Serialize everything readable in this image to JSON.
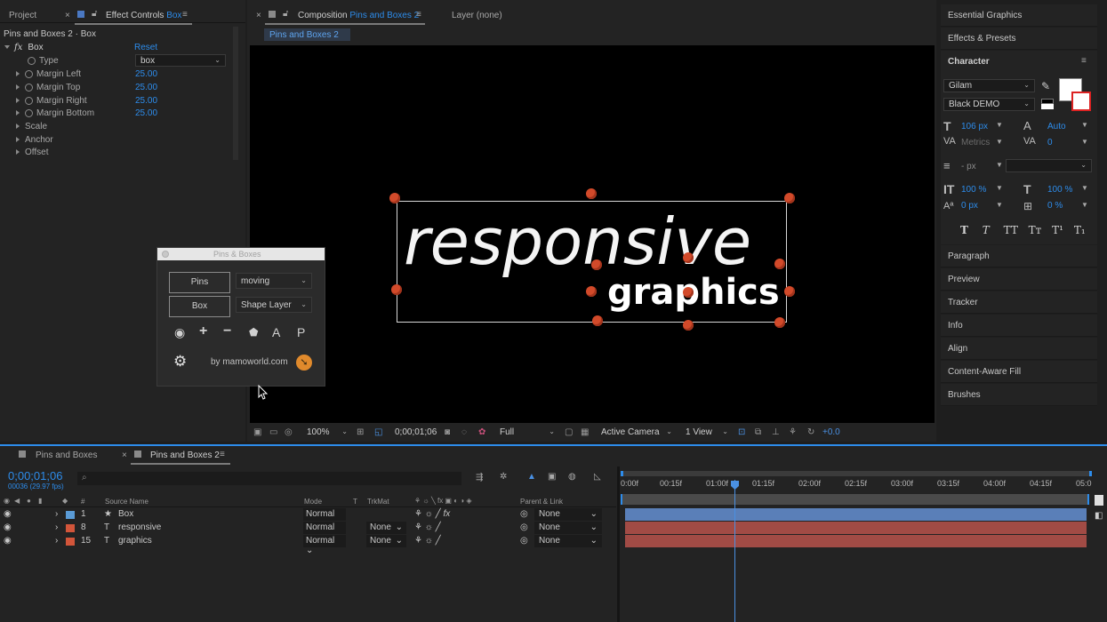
{
  "project_panel": {
    "tab_project": "Project",
    "tab_effect_controls": "Effect Controls",
    "tab_effect_layer": "Box",
    "breadcrumb": "Pins and Boxes 2 · Box",
    "effect_name": "Box",
    "reset": "Reset",
    "props": [
      {
        "label": "Type",
        "value": "box"
      },
      {
        "label": "Margin Left",
        "value": "25.00"
      },
      {
        "label": "Margin Top",
        "value": "25.00"
      },
      {
        "label": "Margin Right",
        "value": "25.00"
      },
      {
        "label": "Margin Bottom",
        "value": "25.00"
      }
    ],
    "groups": [
      "Scale",
      "Anchor",
      "Offset"
    ]
  },
  "composition": {
    "tab_label": "Composition",
    "tab_name": "Pins and Boxes 2",
    "layer_tab": "Layer (none)",
    "sub_tab": "Pins and Boxes 2",
    "text_top": "responsive",
    "text_bottom": "graphics"
  },
  "viewer_toolbar": {
    "zoom": "100%",
    "timecode": "0;00;01;06",
    "resolution": "Full",
    "camera": "Active Camera",
    "views": "1 View",
    "exposure": "+0.0"
  },
  "pins_boxes": {
    "title": "Pins & Boxes",
    "pins_btn": "Pins",
    "pins_mode": "moving",
    "box_btn": "Box",
    "box_mode": "Shape Layer",
    "letter_a": "A",
    "letter_p": "P",
    "credit": "by mamoworld.com"
  },
  "right_panel": {
    "essential_graphics": "Essential Graphics",
    "effects_presets": "Effects & Presets",
    "character": "Character",
    "font_family": "Gilam",
    "font_style": "Black DEMO",
    "font_size": "106 px",
    "leading": "Auto",
    "kerning": "Metrics",
    "tracking": "0",
    "line_px": "- px",
    "vscale": "100 %",
    "hscale": "100 %",
    "baseline": "0 px",
    "tsume": "0 %",
    "sections": [
      "Paragraph",
      "Preview",
      "Tracker",
      "Info",
      "Align",
      "Content-Aware Fill",
      "Brushes"
    ]
  },
  "timeline": {
    "tab1": "Pins and Boxes",
    "tab2": "Pins and Boxes 2",
    "timecode": "0;00;01;06",
    "frame_info": "00036 (29.97 fps)",
    "col_num": "#",
    "col_source": "Source Name",
    "col_mode": "Mode",
    "col_t": "T",
    "col_trkmat": "TrkMat",
    "col_parent": "Parent & Link",
    "ticks": [
      "0:00f",
      "00:15f",
      "01:00f",
      "01:15f",
      "02:00f",
      "02:15f",
      "03:00f",
      "03:15f",
      "04:00f",
      "04:15f",
      "05:0"
    ],
    "layers": [
      {
        "num": "1",
        "type": "★",
        "name": "Box",
        "mode": "Normal",
        "trkmat": "",
        "parent": "None",
        "color": "#5a9bd6"
      },
      {
        "num": "8",
        "type": "T",
        "name": "responsive",
        "mode": "Normal",
        "trkmat": "None",
        "parent": "None",
        "color": "#d2553a"
      },
      {
        "num": "15",
        "type": "T",
        "name": "graphics",
        "mode": "Normal",
        "trkmat": "None",
        "parent": "None",
        "color": "#d2553a"
      }
    ]
  },
  "colors": {
    "accent": "#2d8ceb",
    "layer_blue": "#5a7fb8",
    "layer_red": "#a14b45",
    "pin": "#d24a2a"
  }
}
